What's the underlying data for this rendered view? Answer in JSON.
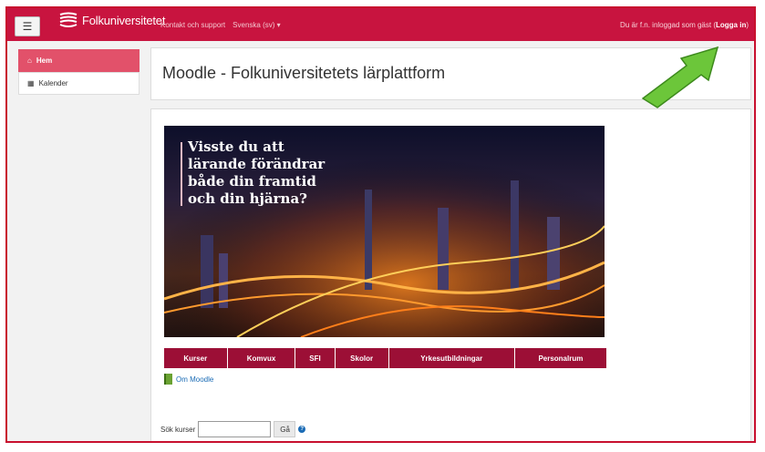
{
  "navbar": {
    "brand": "Folkuniversitetet",
    "links": [
      "Kontakt och support",
      "Svenska (sv) ▾"
    ],
    "login_prefix": "Du är f.n. inloggad som gäst (",
    "login_link": "Logga in",
    "login_suffix": ")",
    "bg_color": "#c8143f"
  },
  "drawer": {
    "items": [
      {
        "icon": "home-icon",
        "glyph": "⌂",
        "label": "Hem",
        "active": true
      },
      {
        "icon": "calendar-icon",
        "glyph": "▦",
        "label": "Kalender",
        "active": false
      }
    ]
  },
  "page": {
    "title": "Moodle - Folkuniversitetets lärplattform"
  },
  "hero": {
    "lines": [
      "Visste du att",
      "lärande förändrar",
      "både din framtid",
      "och din hjärna?"
    ]
  },
  "menu": {
    "items": [
      {
        "label": "Kurser",
        "flex": 1.3
      },
      {
        "label": "Komvux",
        "flex": 1.4
      },
      {
        "label": "SFI",
        "flex": 0.8
      },
      {
        "label": "Skolor",
        "flex": 1.1
      },
      {
        "label": "Yrkesutbildningar",
        "flex": 2.6
      },
      {
        "label": "Personalrum",
        "flex": 1.9
      }
    ],
    "color": "#9c0f36"
  },
  "about": {
    "label": "Om Moodle"
  },
  "search": {
    "label": "Sök kurser",
    "value": "",
    "button": "Gå",
    "help": "?"
  },
  "annotation": {
    "arrow_color": "#6cc63a"
  }
}
